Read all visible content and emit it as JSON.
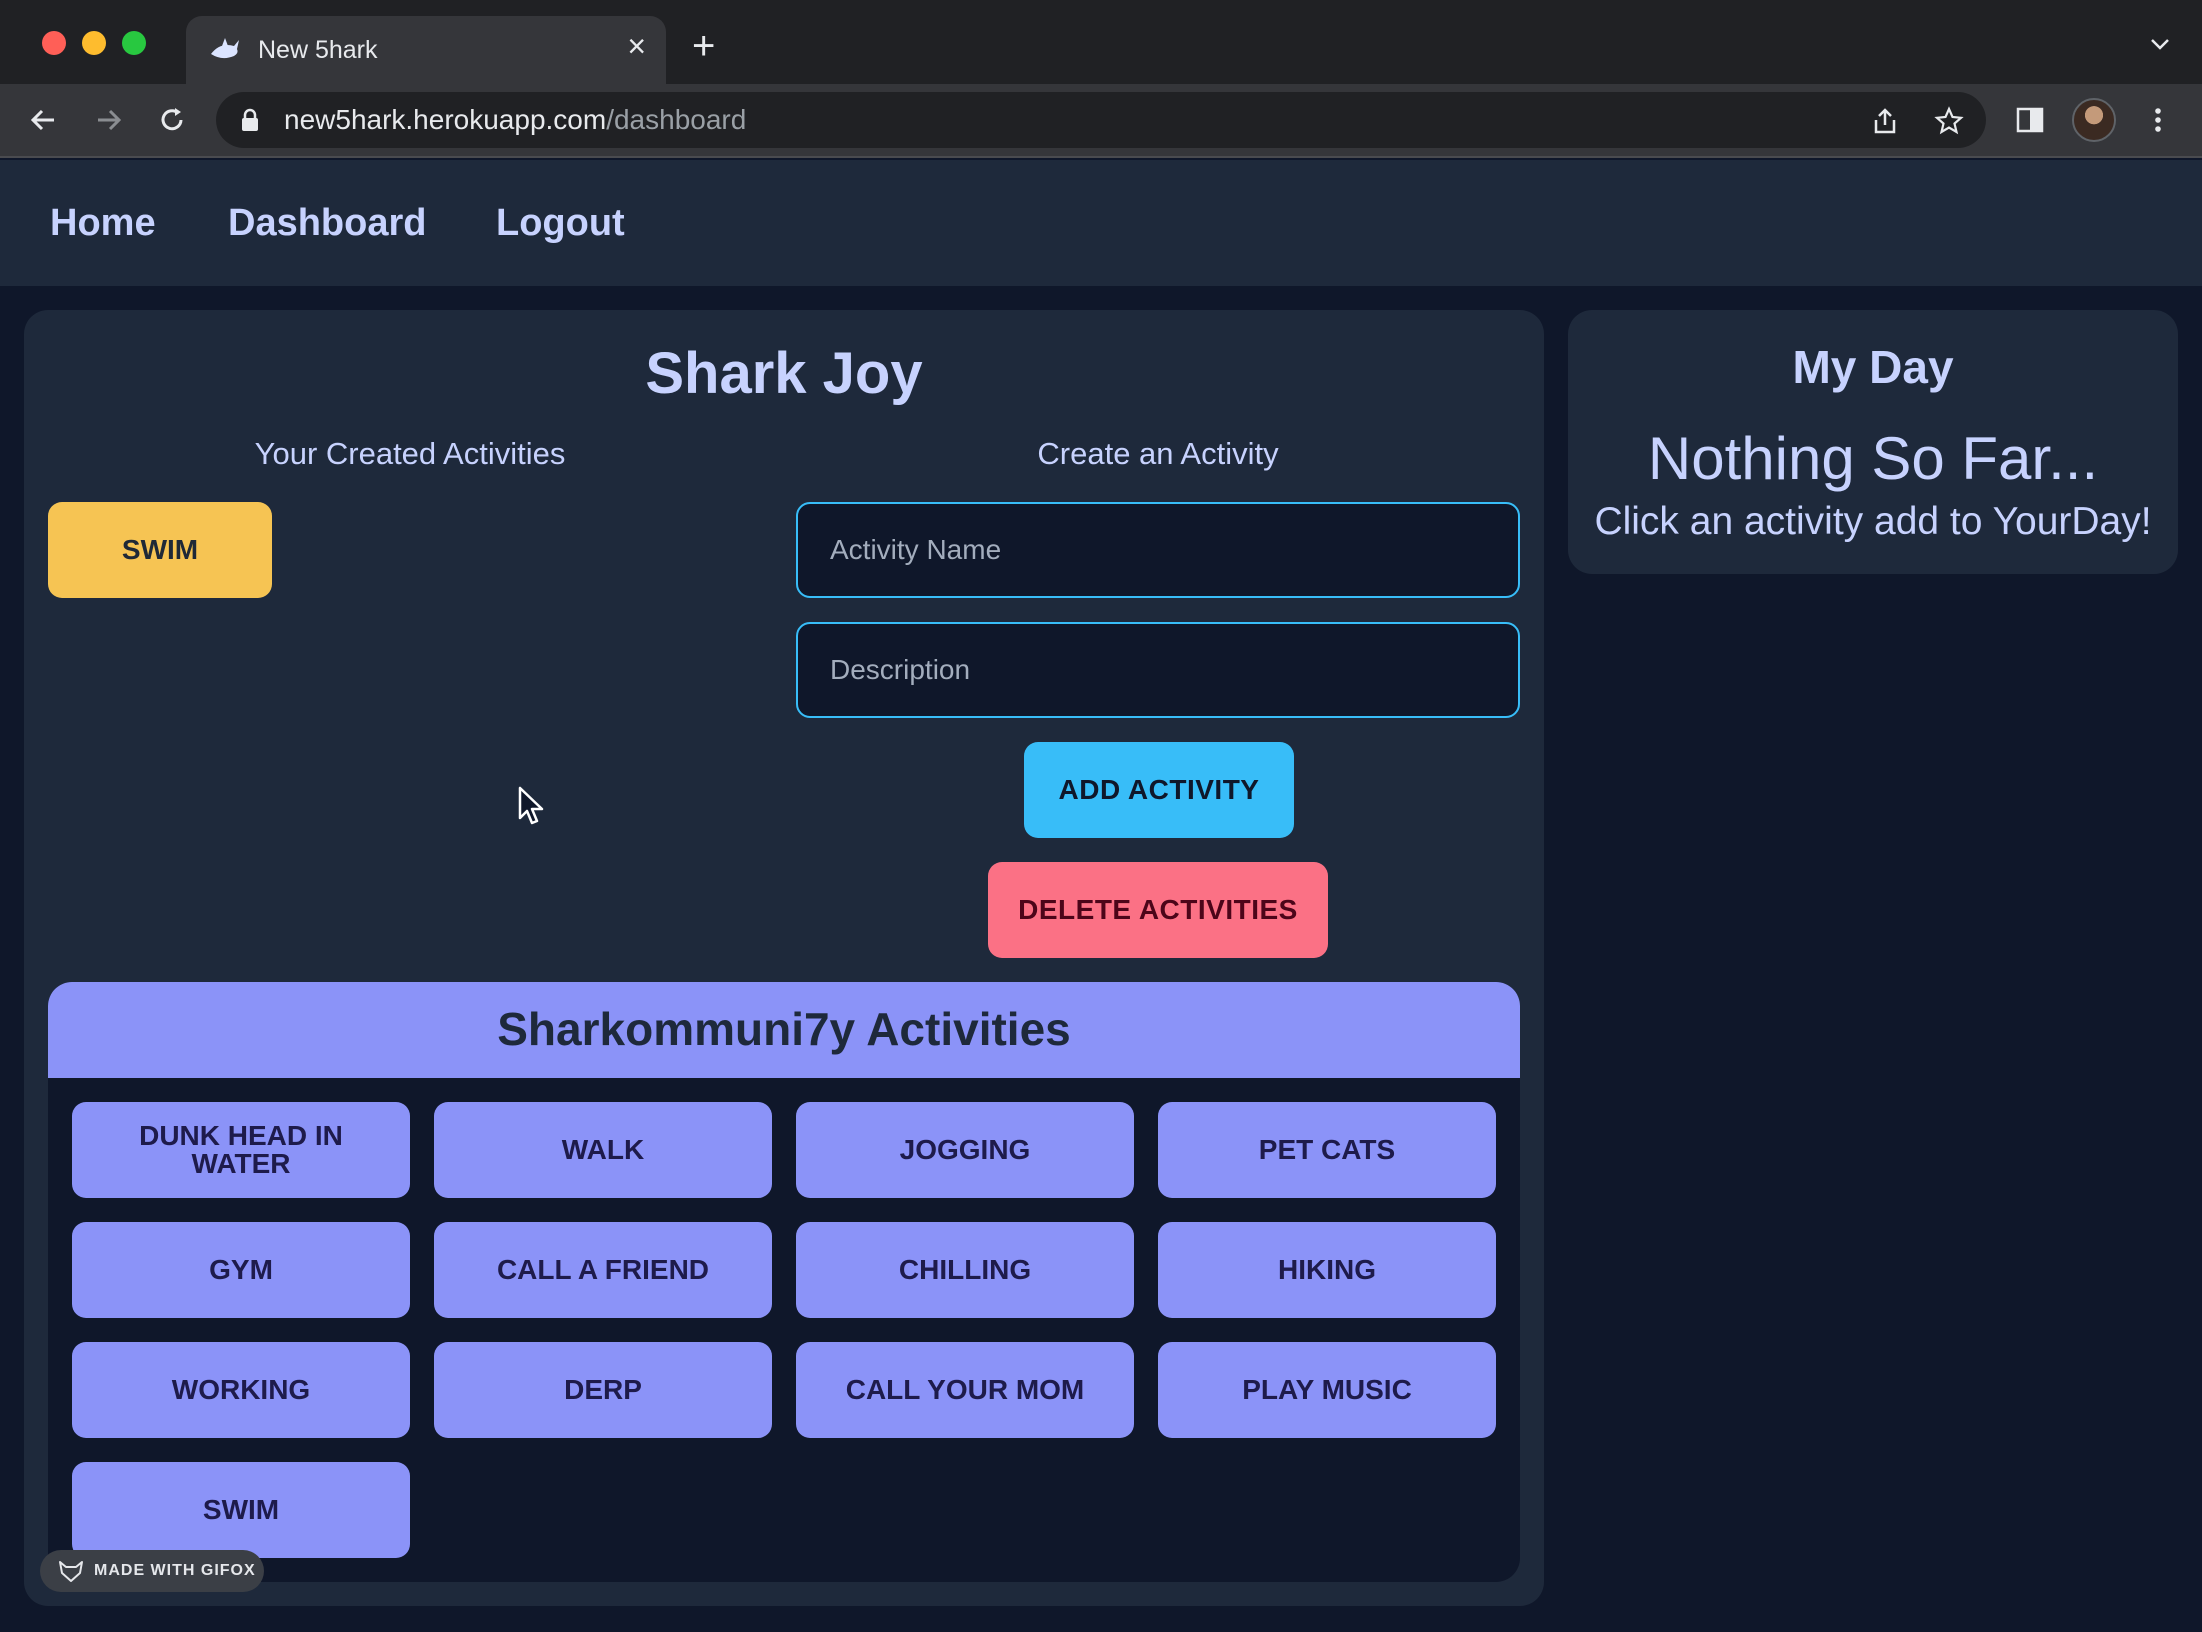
{
  "browser": {
    "tab_title": "New 5hark",
    "url_host": "new5hark.herokuapp.com",
    "url_path": "/dashboard"
  },
  "nav": {
    "home": "Home",
    "dashboard": "Dashboard",
    "logout": "Logout"
  },
  "main": {
    "title": "Shark Joy",
    "created_title": "Your Created Activities",
    "created_activities": [
      "SWIM"
    ],
    "create_title": "Create an Activity",
    "activity_name_placeholder": "Activity Name",
    "description_placeholder": "Description",
    "add_label": "ADD ACTIVITY",
    "delete_label": "DELETE ACTIVITIES"
  },
  "community": {
    "title": "Sharkommuni7y Activities",
    "activities": [
      "DUNK HEAD IN WATER",
      "WALK",
      "JOGGING",
      "PET CATS",
      "GYM",
      "CALL A FRIEND",
      "CHILLING",
      "HIKING",
      "WORKING",
      "DERP",
      "CALL YOUR MOM",
      "PLAY MUSIC",
      "SWIM"
    ]
  },
  "my_day": {
    "title": "My Day",
    "empty_text": "Nothing So Far...",
    "hint": "Click an activity add to YourDay!"
  },
  "watermark": "MADE WITH GIFOX",
  "colors": {
    "page_bg": "#0f172a",
    "card_bg": "#1e293b",
    "accent_text": "#c7d2fe",
    "created_activity": "#f6c453",
    "add_button": "#38bdf8",
    "delete_button": "#fb7185",
    "community": "#8b93f8"
  }
}
